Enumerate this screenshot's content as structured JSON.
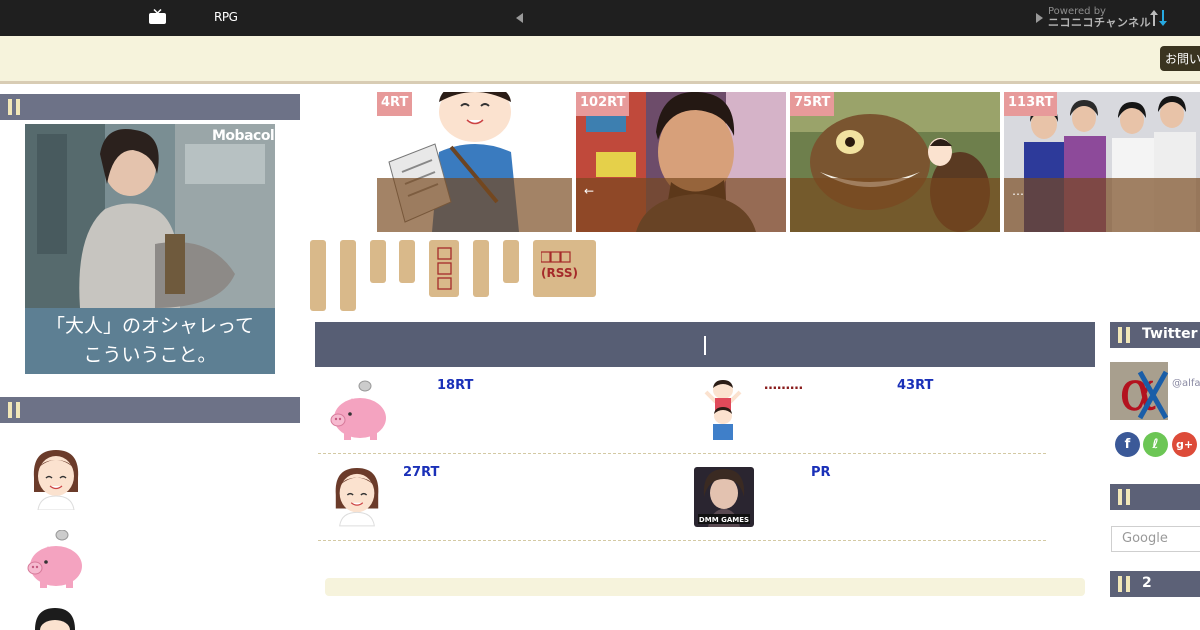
{
  "topbar": {
    "title": "RPG",
    "powered_by_label": "Powered by",
    "powered_by_brand": "ニコニコチャンネル",
    "icons": [
      "tv-icon",
      "prev-arrow-icon",
      "next-arrow-icon",
      "sort-updown-icon"
    ]
  },
  "banner": {
    "contact_button": "お問い"
  },
  "left_sidebar": {
    "ad": {
      "logo": "Mobacolle",
      "caption_line1": "「大人」のオシャレって",
      "caption_line2": "こういうこと。"
    }
  },
  "thumbnails": [
    {
      "badge": "4RT",
      "overlay": ""
    },
    {
      "badge": "102RT",
      "overlay": "←"
    },
    {
      "badge": "75RT",
      "overlay": ""
    },
    {
      "badge": "113RT",
      "overlay": "…"
    }
  ],
  "tabs": {
    "rss_label_line1": "",
    "rss_label_line2": "(RSS)"
  },
  "articles": [
    {
      "rt": "18RT",
      "icon": "piggy-bank-icon"
    },
    {
      "dots": "………",
      "rt": "43RT",
      "icon": "family-icon"
    },
    {
      "rt": "27RT",
      "icon": "woman-icon"
    },
    {
      "rt": "PR",
      "icon": "game-thumb"
    }
  ],
  "right_sidebar": {
    "twitter_heading": "Twitter",
    "twitter_handle": "@alfa",
    "search_placeholder": "Google",
    "section2_heading": "2",
    "social": {
      "facebook": "f",
      "feedly": "ℓ",
      "google_plus": "g+"
    }
  },
  "colors": {
    "topbar": "#1f1f1f",
    "banner": "#f6f3dc",
    "section_header": "#6d7287",
    "main_header": "#575e74",
    "tab": "#d9b98a",
    "badge": "#e79a9a",
    "rt_link": "#1a30b8"
  }
}
